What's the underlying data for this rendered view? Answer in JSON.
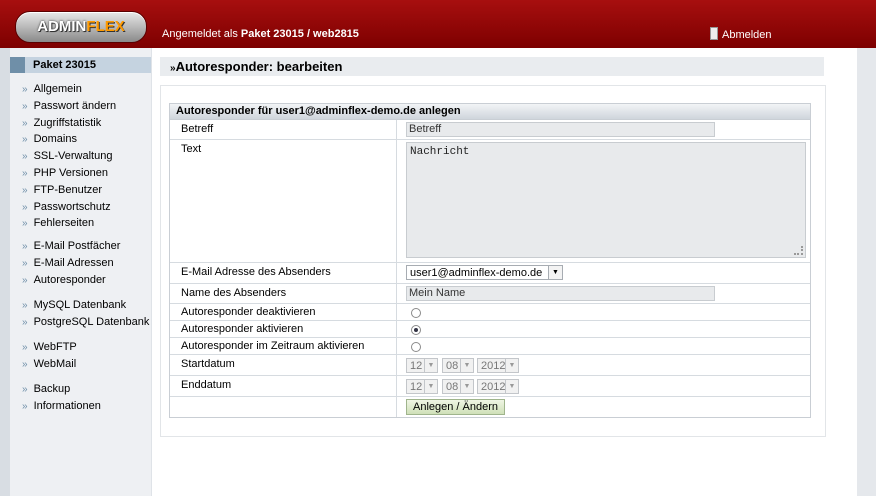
{
  "header": {
    "logo_part1": "ADMIN",
    "logo_part2": "FLEX",
    "login_prefix": "Angemeldet als",
    "login_account": "Paket 23015 / web2815",
    "logout_label": "Abmelden"
  },
  "sidebar": {
    "heading": "Paket 23015",
    "groups": [
      [
        "Allgemein",
        "Passwort ändern",
        "Zugriffstatistik",
        "Domains",
        "SSL-Verwaltung",
        "PHP Versionen",
        "FTP-Benutzer",
        "Passwortschutz",
        "Fehlerseiten"
      ],
      [
        "E-Mail Postfächer",
        "E-Mail Adressen",
        "Autoresponder"
      ],
      [
        "MySQL Datenbank",
        "PostgreSQL Datenbank"
      ],
      [
        "WebFTP",
        "WebMail"
      ],
      [
        "Backup",
        "Informationen"
      ]
    ]
  },
  "page": {
    "title": "Autoresponder: bearbeiten"
  },
  "form": {
    "heading": "Autoresponder für user1@adminflex-demo.de anlegen",
    "subject_label": "Betreff",
    "subject_value": "Betreff",
    "text_label": "Text",
    "text_value": "Nachricht",
    "sender_email_label": "E-Mail Adresse des Absenders",
    "sender_email_value": "user1@adminflex-demo.de",
    "sender_name_label": "Name des Absenders",
    "sender_name_value": "Mein Name",
    "radio_deactivate": "Autoresponder deaktivieren",
    "radio_activate": "Autoresponder aktivieren",
    "radio_period": "Autoresponder im Zeitraum aktivieren",
    "selected_option": "activate",
    "start_label": "Startdatum",
    "start": {
      "day": "12",
      "month": "08",
      "year": "2012"
    },
    "end_label": "Enddatum",
    "end": {
      "day": "12",
      "month": "08",
      "year": "2012"
    },
    "submit_label": "Anlegen / Ändern"
  }
}
